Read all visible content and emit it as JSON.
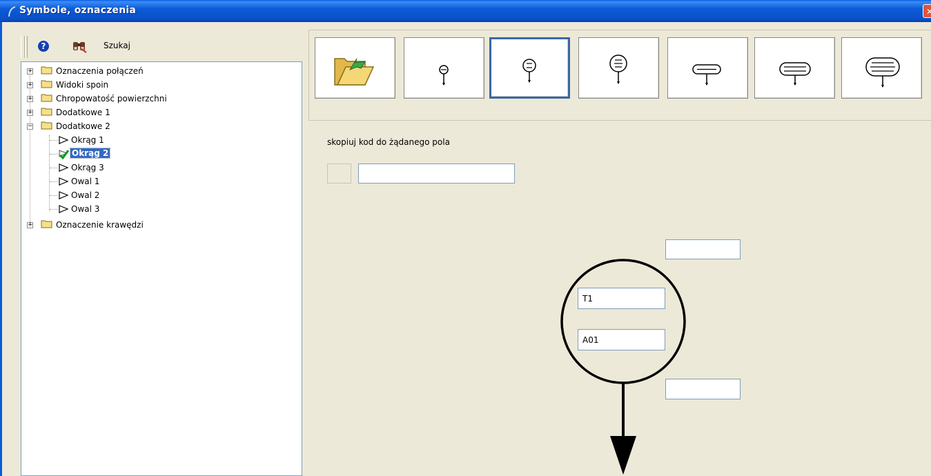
{
  "window": {
    "title": "Symbole, oznaczenia",
    "close_glyph": "✕"
  },
  "toolbar": {
    "help_glyph": "?",
    "search_label": "Szukaj"
  },
  "tree": {
    "expanded_glyph": "−",
    "collapsed_glyph": "+",
    "nodes": [
      {
        "label": "Oznaczenia połączeń",
        "type": "folder",
        "expanded": false
      },
      {
        "label": "Widoki spoin",
        "type": "folder",
        "expanded": false
      },
      {
        "label": "Chropowatość powierzchni",
        "type": "folder",
        "expanded": false
      },
      {
        "label": "Dodatkowe 1",
        "type": "folder",
        "expanded": false
      },
      {
        "label": "Dodatkowe 2",
        "type": "folder",
        "expanded": true,
        "children": [
          {
            "label": "Okrąg 1",
            "selected": false
          },
          {
            "label": "Okrąg 2",
            "selected": true
          },
          {
            "label": "Okrąg 3",
            "selected": false
          },
          {
            "label": "Owal 1",
            "selected": false
          },
          {
            "label": "Owal 2",
            "selected": false
          },
          {
            "label": "Owal 3",
            "selected": false
          }
        ]
      },
      {
        "label": "Oznaczenie krawędzi",
        "type": "folder",
        "expanded": false
      }
    ]
  },
  "symbol_buttons": [
    {
      "name": "open-folder",
      "icon": "open-folder-icon",
      "active": false
    },
    {
      "name": "circle-1",
      "icon": "circle-1-line-icon",
      "active": false
    },
    {
      "name": "circle-2",
      "icon": "circle-2-line-icon",
      "active": true
    },
    {
      "name": "circle-3",
      "icon": "circle-3-line-icon",
      "active": false
    },
    {
      "name": "oval-1",
      "icon": "oval-1-line-icon",
      "active": false
    },
    {
      "name": "oval-2",
      "icon": "oval-2-line-icon",
      "active": false
    },
    {
      "name": "oval-3",
      "icon": "oval-3-line-icon",
      "active": false
    }
  ],
  "main": {
    "hint": "skopiuj kod do żądanego pola",
    "code_value": "",
    "field_top_value": "",
    "field_t1_value": "T1",
    "field_a01_value": "A01",
    "field_bottom_value": ""
  },
  "colors": {
    "titlebar": "#0A50C8",
    "window_bg": "#ECE9D8",
    "selection": "#316AC5",
    "active_button_border": "#3A67A8"
  }
}
